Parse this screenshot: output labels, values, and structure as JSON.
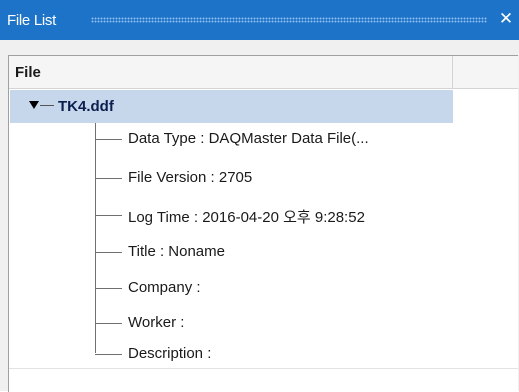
{
  "window": {
    "title": "File List",
    "close_glyph": "✕",
    "title_bar_color": "#1c73c8"
  },
  "table": {
    "column_header": "File"
  },
  "tree": {
    "root": {
      "label": "TK4.ddf",
      "expanded": true,
      "selected": true,
      "selection_color": "#c6d7ec"
    },
    "children": [
      {
        "label": "Data Type : DAQMaster Data File(..."
      },
      {
        "label": "File Version : 2705"
      },
      {
        "label": "Log Time : 2016-04-20 오후 9:28:52"
      },
      {
        "label": "Title : Noname"
      },
      {
        "label": "Company :"
      },
      {
        "label": "Worker :"
      },
      {
        "label": "Description :"
      }
    ]
  }
}
